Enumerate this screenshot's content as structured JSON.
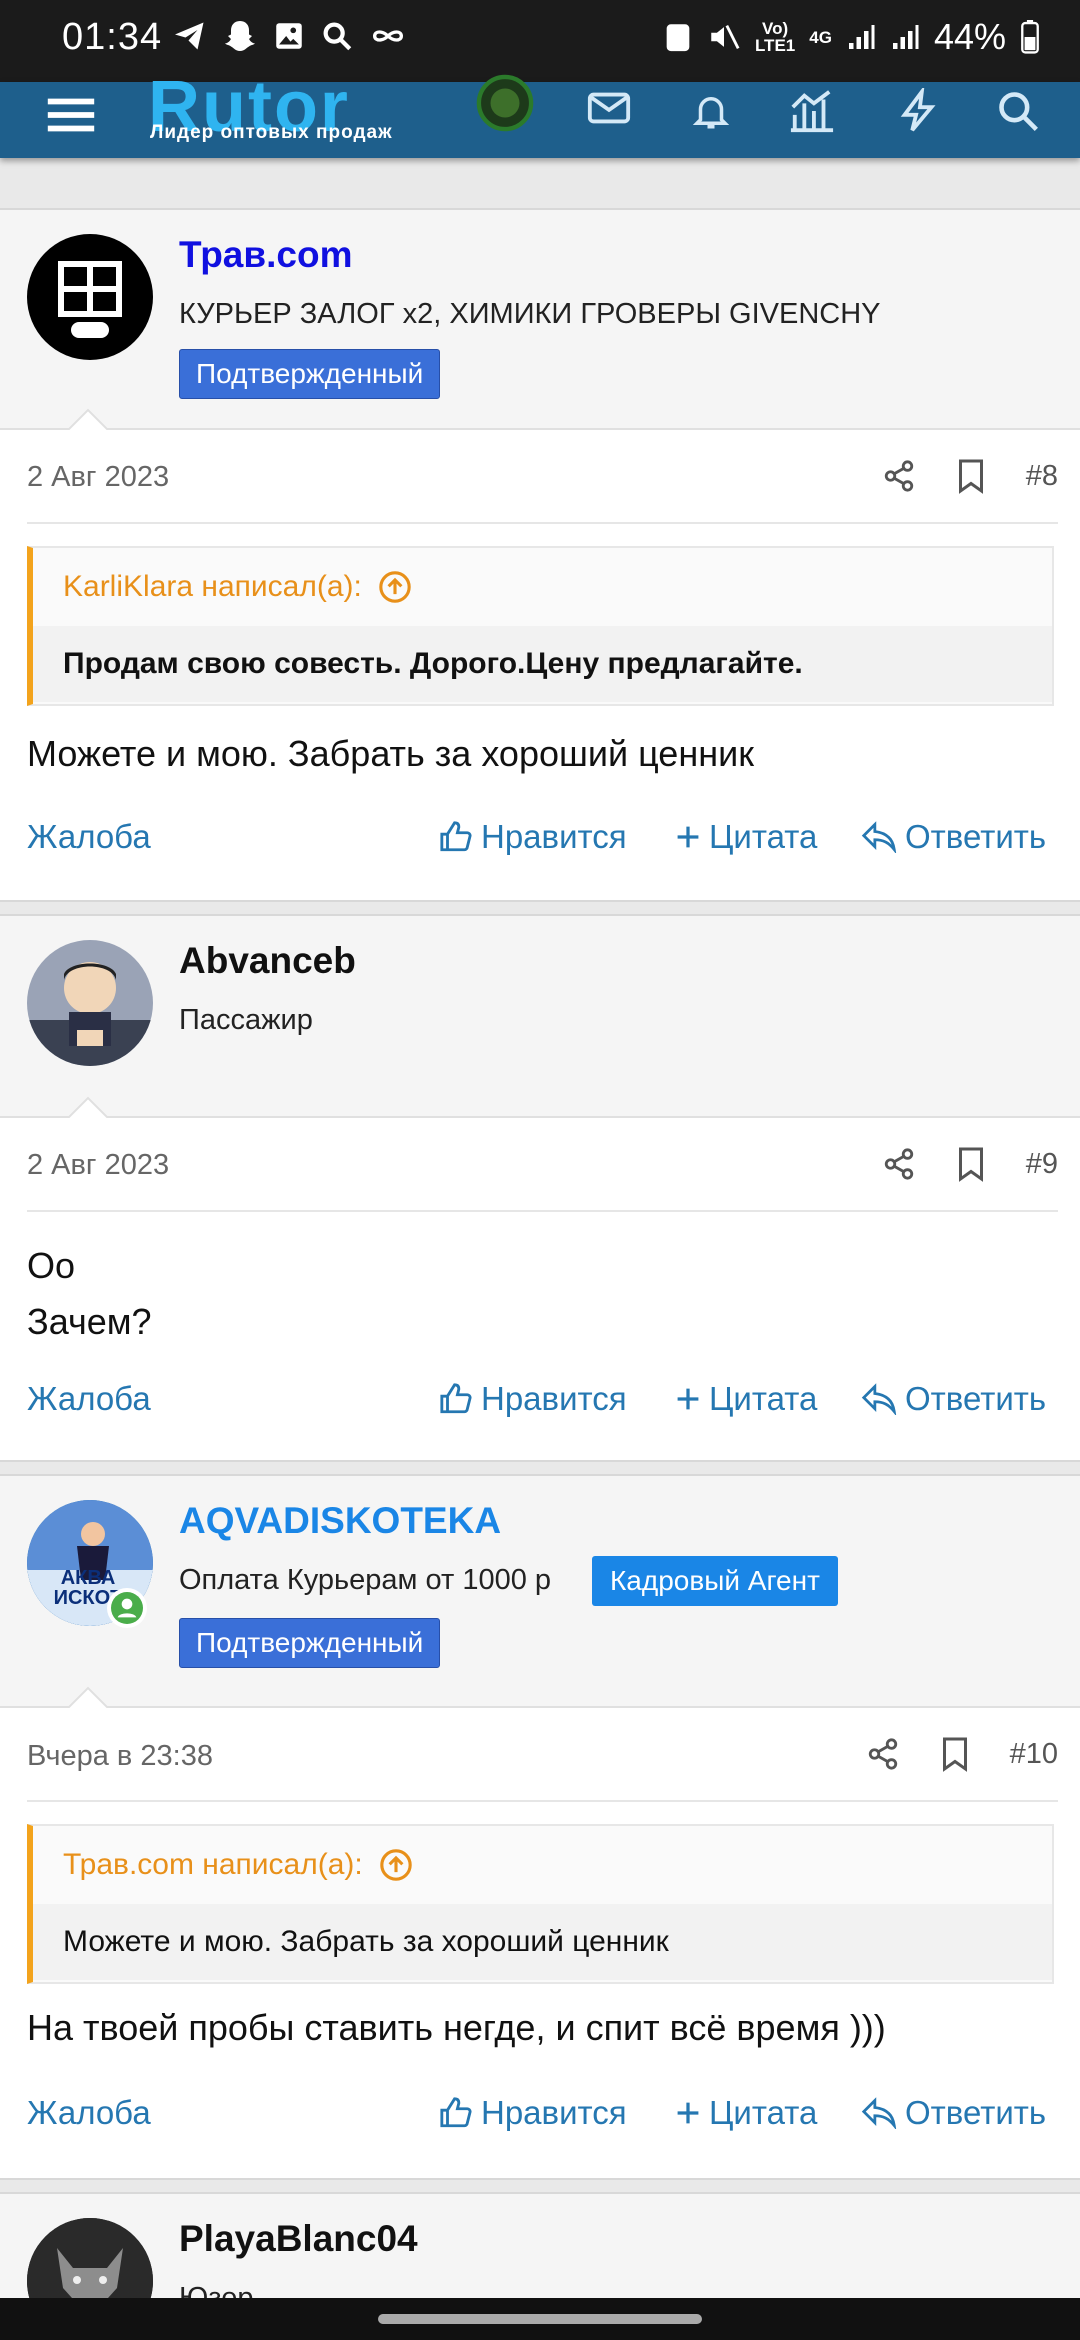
{
  "status_bar": {
    "time": "01:34",
    "battery": "44%",
    "network_top": "Vo)",
    "network_bottom": "LTE1",
    "gen": "4G"
  },
  "header": {
    "logo": "Rutor",
    "tagline": "Лидер оптовых продаж"
  },
  "posts": [
    {
      "username": "Трав.com",
      "user_title": "КУРЬЕР ЗАЛОГ x2, ХИМИКИ ГРОВЕРЫ GIVENCHY",
      "badge": "Подтвержденный",
      "date": "2 Авг 2023",
      "number": "#8",
      "quote_author": "KarliKlara написал(а):",
      "quote_text": "Продам свою совесть. Дорого.Цену предлагайте.",
      "text": "Можете и мою. Забрать за хороший ценник"
    },
    {
      "username": "Abvanceb",
      "user_title": "Пассажир",
      "date": "2 Авг 2023",
      "number": "#9",
      "text_line1": "Оо",
      "text_line2": "Зачем?"
    },
    {
      "username": "AQVADISKOTEKA",
      "user_title": "Оплата Курьерам от 1000 р",
      "role_badge": "Кадровый Агент",
      "badge": "Подтвержденный",
      "avatar_text": "АКВА ИСКОТ",
      "date": "Вчера в 23:38",
      "number": "#10",
      "quote_author": "Трав.com написал(а):",
      "quote_text": "Можете и мою. Забрать за хороший ценник",
      "text": "На твоей пробы ставить негде, и спит всё время )))"
    },
    {
      "username": "PlayaBlanc04",
      "user_title": "Юзер"
    }
  ],
  "actions": {
    "report": "Жалоба",
    "like": "Нравится",
    "quote": "Цитата",
    "reply": "Ответить"
  },
  "colors": {
    "header_bg": "#1e5f8c",
    "link_blue": "#2577b1",
    "username_blue": "#1010e0",
    "quote_accent": "#f3a31c",
    "badge_blue": "#3a6fd8"
  }
}
